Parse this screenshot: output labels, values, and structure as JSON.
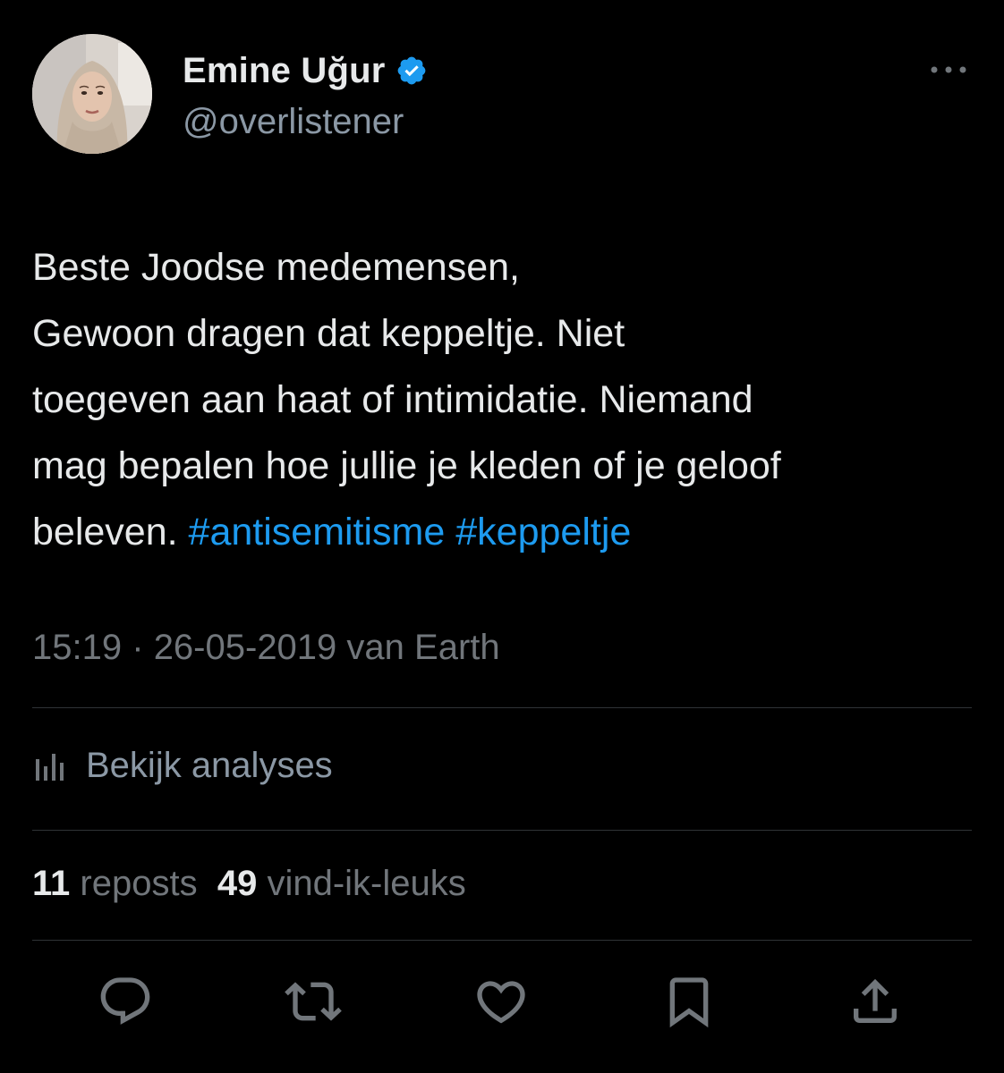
{
  "author": {
    "display_name": "Emine Uğur",
    "handle": "@overlistener",
    "avatar_icon": "profile-photo",
    "verified_icon": "verified-badge-icon",
    "verified_color": "#1d9bf0"
  },
  "more_icon": "more-dots-icon",
  "tweet": {
    "lines": [
      "Beste Joodse medemensen,",
      "Gewoon dragen dat keppeltje. Niet",
      "toegeven aan haat of intimidatie. Niemand",
      "mag bepalen hoe jullie je kleden of je geloof"
    ],
    "last_line_text": "beleven. ",
    "hashtags": [
      "#antisemitisme",
      "#keppeltje"
    ]
  },
  "meta": {
    "time": "15:19",
    "separator": "·",
    "date": "26-05-2019",
    "source": "van Earth"
  },
  "analytics": {
    "label": "Bekijk analyses",
    "icon": "analytics-bars-icon"
  },
  "stats": {
    "reposts_count": "11",
    "reposts_label": "reposts",
    "likes_count": "49",
    "likes_label": "vind-ik-leuks"
  },
  "actions": [
    {
      "name": "reply",
      "icon": "reply-icon"
    },
    {
      "name": "repost",
      "icon": "repost-icon"
    },
    {
      "name": "like",
      "icon": "heart-icon"
    },
    {
      "name": "bookmark",
      "icon": "bookmark-icon"
    },
    {
      "name": "share",
      "icon": "share-icon"
    }
  ],
  "colors": {
    "background": "#000000",
    "text": "#e7e9ea",
    "secondary": "#71767b",
    "accent": "#1d9bf0",
    "divider": "#2f3336"
  }
}
